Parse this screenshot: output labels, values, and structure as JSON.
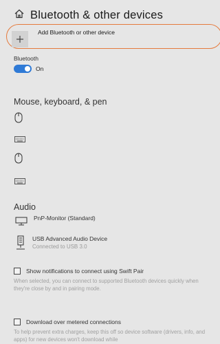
{
  "header": {
    "title": "Bluetooth & other devices",
    "icon": "home-icon"
  },
  "add_device": {
    "label": "Add Bluetooth or other device",
    "icon": "plus-icon"
  },
  "bluetooth": {
    "label": "Bluetooth",
    "state_label": "On",
    "enabled": true,
    "accent": "#2f7ad6"
  },
  "sections": {
    "mouse_keyboard": "Mouse, keyboard, & pen",
    "audio": "Audio"
  },
  "mouse_keyboard_devices": [
    {
      "icon": "mouse-icon"
    },
    {
      "icon": "keyboard-icon"
    },
    {
      "icon": "mouse-icon"
    },
    {
      "icon": "keyboard-icon"
    }
  ],
  "audio_devices": [
    {
      "icon": "monitor-icon",
      "name": "PnP-Monitor (Standard)",
      "status": ""
    },
    {
      "icon": "speaker-icon",
      "name": "USB Advanced Audio Device",
      "status": "Connected to USB 3.0"
    }
  ],
  "swift_pair": {
    "label": "Show notifications to connect using Swift Pair",
    "checked": false,
    "description": "When selected, you can connect to supported Bluetooth devices quickly when they're close by and in pairing mode."
  },
  "metered": {
    "label": "Download over metered connections",
    "checked": false,
    "description": "To help prevent extra charges, keep this off so device software (drivers, info, and apps) for new devices won't download while"
  },
  "colors": {
    "highlight": "#e57a3c",
    "background": "#e6e6e6"
  }
}
